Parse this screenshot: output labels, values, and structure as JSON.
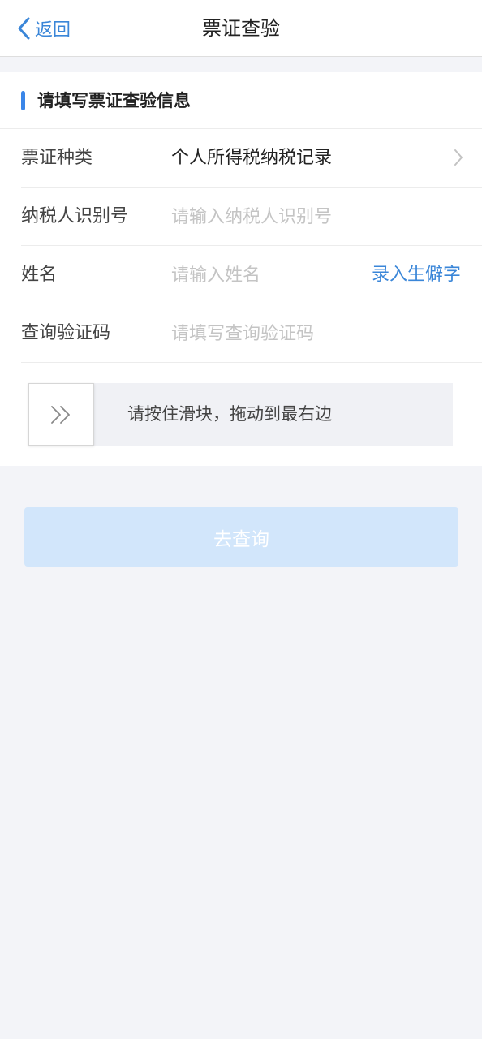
{
  "nav": {
    "back_label": "返回",
    "title": "票证查验"
  },
  "section": {
    "title": "请填写票证查验信息"
  },
  "form": {
    "ticket_type": {
      "label": "票证种类",
      "value": "个人所得税纳税记录"
    },
    "taxpayer_id": {
      "label": "纳税人识别号",
      "value": "",
      "placeholder": "请输入纳税人识别号"
    },
    "name": {
      "label": "姓名",
      "value": "",
      "placeholder": "请输入姓名",
      "rare_char_link": "录入生僻字"
    },
    "verify_code": {
      "label": "查询验证码",
      "value": "",
      "placeholder": "请填写查询验证码"
    }
  },
  "slider": {
    "text": "请按住滑块，拖动到最右边",
    "progress": 0
  },
  "submit": {
    "label": "去查询"
  },
  "colors": {
    "accent": "#3a86d8",
    "button_disabled_bg": "#d2e6fb",
    "page_bg": "#f3f4f8"
  },
  "icons": {
    "back": "chevron-left-icon",
    "row_arrow": "chevron-right-icon",
    "slider_handle": "double-chevron-right-icon"
  }
}
